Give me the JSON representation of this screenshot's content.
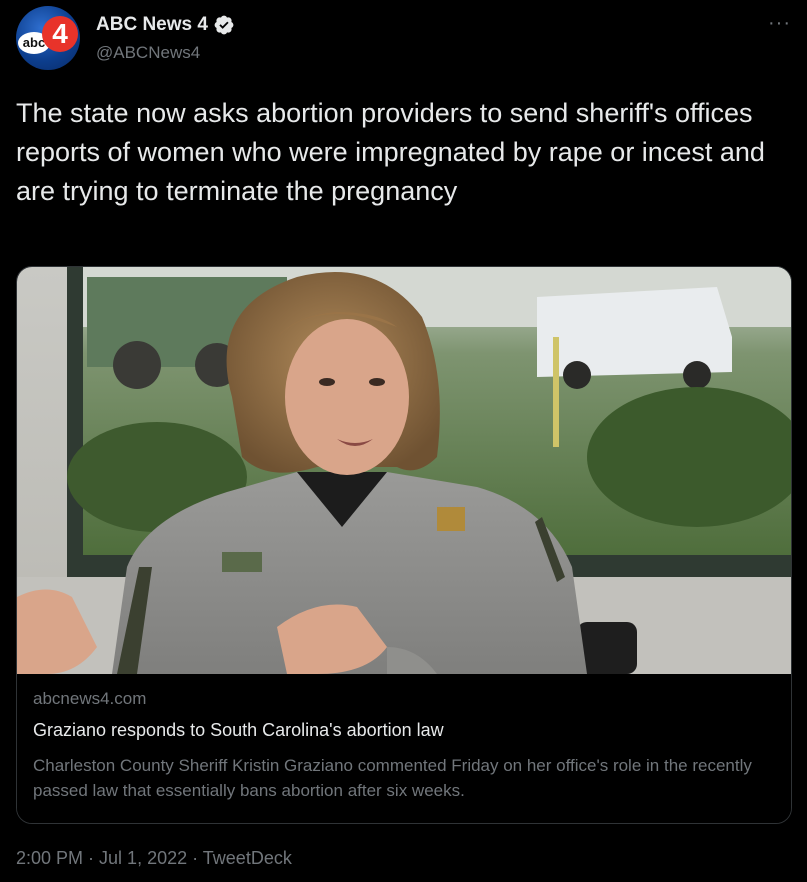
{
  "author": {
    "display_name": "ABC News 4",
    "handle": "@ABCNews4",
    "verified": true,
    "avatar_text": {
      "abc": "abc",
      "number": "4"
    }
  },
  "more_label": "···",
  "tweet_text": "The state now asks abortion providers to send sheriff's offices reports of women who were impregnated by rape or incest and are trying to terminate the pregnancy",
  "card": {
    "domain": "abcnews4.com",
    "title": "Graziano responds to South Carolina's abortion law",
    "description": "Charleston County Sheriff Kristin Graziano commented Friday on her office's role in the recently passed law that essentially bans abortion after six weeks."
  },
  "meta": {
    "time": "2:00 PM",
    "separator": " · ",
    "date": "Jul 1, 2022",
    "source": "TweetDeck"
  },
  "colors": {
    "background": "#000000",
    "primary_text": "#e7e9ea",
    "secondary_text": "#71767b",
    "border": "#2f3336",
    "verified_badge": "#e7e9ea"
  }
}
